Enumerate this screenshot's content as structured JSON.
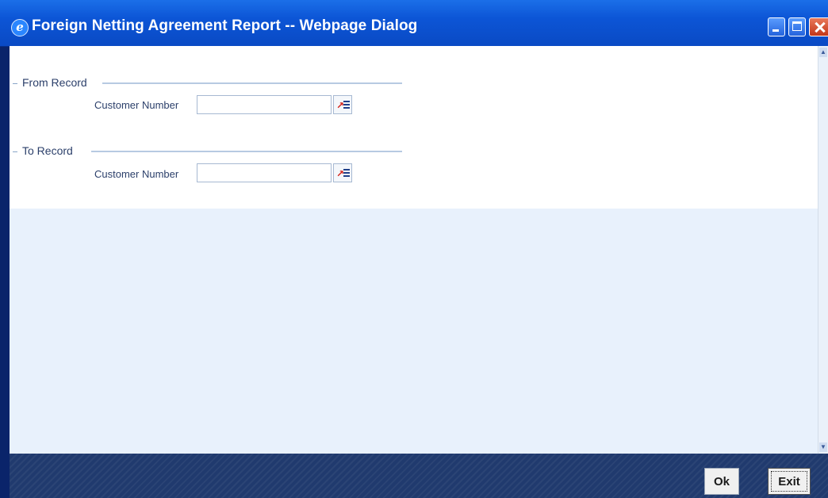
{
  "window": {
    "title": "Foreign Netting Agreement Report -- Webpage Dialog",
    "icon": "ie-icon"
  },
  "sections": [
    {
      "title": "From Record",
      "field_label": "Customer Number",
      "value": "",
      "placeholder": ""
    },
    {
      "title": "To Record",
      "field_label": "Customer Number",
      "value": "",
      "placeholder": ""
    }
  ],
  "footer": {
    "ok_label": "Ok",
    "exit_label": "Exit"
  },
  "colors": {
    "titlebar": "#0c55d6",
    "footer": "#203a6e",
    "content_bg": "#e8f1fc"
  }
}
